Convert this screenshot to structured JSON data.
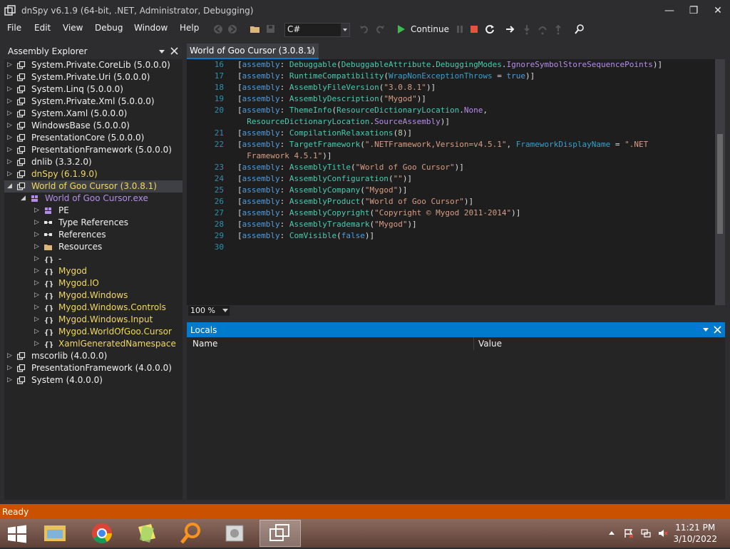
{
  "window": {
    "title": "dnSpy v6.1.9 (64-bit, .NET, Administrator, Debugging)",
    "minimize": "—",
    "maximize": "❐",
    "close": "✕"
  },
  "menu": [
    "File",
    "Edit",
    "View",
    "Debug",
    "Window",
    "Help"
  ],
  "toolbar": {
    "language": "C#",
    "continue_label": "Continue"
  },
  "explorer": {
    "title": "Assembly Explorer",
    "items": [
      {
        "label": "System.Private.CoreLib (5.0.0.0)",
        "level": 0,
        "kind": "assembly",
        "expanded": false,
        "color": "#f1f1f1"
      },
      {
        "label": "System.Private.Uri (5.0.0.0)",
        "level": 0,
        "kind": "assembly",
        "expanded": false,
        "color": "#f1f1f1"
      },
      {
        "label": "System.Linq (5.0.0.0)",
        "level": 0,
        "kind": "assembly",
        "expanded": false,
        "color": "#f1f1f1"
      },
      {
        "label": "System.Private.Xml (5.0.0.0)",
        "level": 0,
        "kind": "assembly",
        "expanded": false,
        "color": "#f1f1f1"
      },
      {
        "label": "System.Xaml (5.0.0.0)",
        "level": 0,
        "kind": "assembly",
        "expanded": false,
        "color": "#f1f1f1"
      },
      {
        "label": "WindowsBase (5.0.0.0)",
        "level": 0,
        "kind": "assembly",
        "expanded": false,
        "color": "#f1f1f1"
      },
      {
        "label": "PresentationCore (5.0.0.0)",
        "level": 0,
        "kind": "assembly",
        "expanded": false,
        "color": "#f1f1f1"
      },
      {
        "label": "PresentationFramework (5.0.0.0)",
        "level": 0,
        "kind": "assembly",
        "expanded": false,
        "color": "#f1f1f1"
      },
      {
        "label": "dnlib (3.3.2.0)",
        "level": 0,
        "kind": "assembly",
        "expanded": false,
        "color": "#f1f1f1"
      },
      {
        "label": "dnSpy (6.1.9.0)",
        "level": 0,
        "kind": "assembly-yellow",
        "expanded": false,
        "color": "#f2d860"
      },
      {
        "label": "World of Goo Cursor (3.0.8.1)",
        "level": 0,
        "kind": "assembly-yellow",
        "expanded": true,
        "color": "#f2d860",
        "selected": true
      },
      {
        "label": "World of Goo Cursor.exe",
        "level": 1,
        "kind": "module",
        "expanded": true,
        "color": "#b48ee6"
      },
      {
        "label": "PE",
        "level": 2,
        "kind": "pe",
        "expanded": false,
        "color": "#f1f1f1"
      },
      {
        "label": "Type References",
        "level": 2,
        "kind": "refs",
        "expanded": false,
        "color": "#f1f1f1"
      },
      {
        "label": "References",
        "level": 2,
        "kind": "refs",
        "expanded": false,
        "color": "#f1f1f1"
      },
      {
        "label": "Resources",
        "level": 2,
        "kind": "folder",
        "expanded": false,
        "color": "#f1f1f1"
      },
      {
        "label": "-",
        "level": 2,
        "kind": "namespace",
        "expanded": false,
        "color": "#f1f1f1"
      },
      {
        "label": "Mygod",
        "level": 2,
        "kind": "namespace",
        "expanded": false,
        "color": "#f2d860"
      },
      {
        "label": "Mygod.IO",
        "level": 2,
        "kind": "namespace",
        "expanded": false,
        "color": "#f2d860"
      },
      {
        "label": "Mygod.Windows",
        "level": 2,
        "kind": "namespace",
        "expanded": false,
        "color": "#f2d860"
      },
      {
        "label": "Mygod.Windows.Controls",
        "level": 2,
        "kind": "namespace",
        "expanded": false,
        "color": "#f2d860"
      },
      {
        "label": "Mygod.Windows.Input",
        "level": 2,
        "kind": "namespace",
        "expanded": false,
        "color": "#f2d860"
      },
      {
        "label": "Mygod.WorldOfGoo.Cursor",
        "level": 2,
        "kind": "namespace",
        "expanded": false,
        "color": "#f2d860"
      },
      {
        "label": "XamlGeneratedNamespace",
        "level": 2,
        "kind": "namespace",
        "expanded": false,
        "color": "#f2d860"
      },
      {
        "label": "mscorlib (4.0.0.0)",
        "level": 0,
        "kind": "assembly",
        "expanded": false,
        "color": "#f1f1f1"
      },
      {
        "label": "PresentationFramework (4.0.0.0)",
        "level": 0,
        "kind": "assembly",
        "expanded": false,
        "color": "#f1f1f1"
      },
      {
        "label": "System (4.0.0.0)",
        "level": 0,
        "kind": "assembly",
        "expanded": false,
        "color": "#f1f1f1"
      }
    ]
  },
  "editor": {
    "tab": "World of Goo Cursor (3.0.8.1)",
    "zoom": "100 %",
    "colors": {
      "keyword": "#569cd6",
      "type": "#4ec9b0",
      "string": "#d69d85",
      "number": "#b5cea8",
      "enum": "#b48ee6",
      "plain": "#dcdcdc",
      "param": "#3e9ec5"
    },
    "lines": [
      {
        "n": "16",
        "s": [
          [
            "[",
            "plain"
          ],
          [
            "assembly",
            "keyword"
          ],
          [
            ": ",
            "plain"
          ],
          [
            "Debuggable",
            "type"
          ],
          [
            "(",
            "plain"
          ],
          [
            "DebuggableAttribute",
            "type"
          ],
          [
            ".",
            "plain"
          ],
          [
            "DebuggingModes",
            "type"
          ],
          [
            ".",
            "plain"
          ],
          [
            "IgnoreSymbolStoreSequencePoints",
            "enum"
          ],
          [
            ")]",
            "plain"
          ]
        ]
      },
      {
        "n": "17",
        "s": [
          [
            "[",
            "plain"
          ],
          [
            "assembly",
            "keyword"
          ],
          [
            ": ",
            "plain"
          ],
          [
            "RuntimeCompatibility",
            "type"
          ],
          [
            "(",
            "plain"
          ],
          [
            "WrapNonExceptionThrows",
            "param"
          ],
          [
            " = ",
            "plain"
          ],
          [
            "true",
            "keyword"
          ],
          [
            ")]",
            "plain"
          ]
        ]
      },
      {
        "n": "18",
        "s": [
          [
            "[",
            "plain"
          ],
          [
            "assembly",
            "keyword"
          ],
          [
            ": ",
            "plain"
          ],
          [
            "AssemblyFileVersion",
            "type"
          ],
          [
            "(",
            "plain"
          ],
          [
            "\"3.0.8.1\"",
            "string"
          ],
          [
            ")]",
            "plain"
          ]
        ]
      },
      {
        "n": "19",
        "s": [
          [
            "[",
            "plain"
          ],
          [
            "assembly",
            "keyword"
          ],
          [
            ": ",
            "plain"
          ],
          [
            "AssemblyDescription",
            "type"
          ],
          [
            "(",
            "plain"
          ],
          [
            "\"Mygod\"",
            "string"
          ],
          [
            ")]",
            "plain"
          ]
        ]
      },
      {
        "n": "20",
        "s": [
          [
            "[",
            "plain"
          ],
          [
            "assembly",
            "keyword"
          ],
          [
            ": ",
            "plain"
          ],
          [
            "ThemeInfo",
            "type"
          ],
          [
            "(",
            "plain"
          ],
          [
            "ResourceDictionaryLocation",
            "type"
          ],
          [
            ".",
            "plain"
          ],
          [
            "None",
            "enum"
          ],
          [
            ",",
            "plain"
          ]
        ]
      },
      {
        "n": "",
        "s": [
          [
            "  ResourceDictionaryLocation",
            "type"
          ],
          [
            ".",
            "plain"
          ],
          [
            "SourceAssembly",
            "enum"
          ],
          [
            ")]",
            "plain"
          ]
        ]
      },
      {
        "n": "21",
        "s": [
          [
            "[",
            "plain"
          ],
          [
            "assembly",
            "keyword"
          ],
          [
            ": ",
            "plain"
          ],
          [
            "CompilationRelaxations",
            "type"
          ],
          [
            "(",
            "plain"
          ],
          [
            "8",
            "number"
          ],
          [
            ")]",
            "plain"
          ]
        ]
      },
      {
        "n": "22",
        "s": [
          [
            "[",
            "plain"
          ],
          [
            "assembly",
            "keyword"
          ],
          [
            ": ",
            "plain"
          ],
          [
            "TargetFramework",
            "type"
          ],
          [
            "(",
            "plain"
          ],
          [
            "\".NETFramework,Version=v4.5.1\"",
            "string"
          ],
          [
            ", ",
            "plain"
          ],
          [
            "FrameworkDisplayName",
            "param"
          ],
          [
            " = ",
            "plain"
          ],
          [
            "\".NET",
            "string"
          ]
        ]
      },
      {
        "n": "",
        "s": [
          [
            "  Framework 4.5.1\"",
            "string"
          ],
          [
            ")]",
            "plain"
          ]
        ]
      },
      {
        "n": "23",
        "s": [
          [
            "[",
            "plain"
          ],
          [
            "assembly",
            "keyword"
          ],
          [
            ": ",
            "plain"
          ],
          [
            "AssemblyTitle",
            "type"
          ],
          [
            "(",
            "plain"
          ],
          [
            "\"World of Goo Cursor\"",
            "string"
          ],
          [
            ")]",
            "plain"
          ]
        ]
      },
      {
        "n": "24",
        "s": [
          [
            "[",
            "plain"
          ],
          [
            "assembly",
            "keyword"
          ],
          [
            ": ",
            "plain"
          ],
          [
            "AssemblyConfiguration",
            "type"
          ],
          [
            "(",
            "plain"
          ],
          [
            "\"\"",
            "string"
          ],
          [
            ")]",
            "plain"
          ]
        ]
      },
      {
        "n": "25",
        "s": [
          [
            "[",
            "plain"
          ],
          [
            "assembly",
            "keyword"
          ],
          [
            ": ",
            "plain"
          ],
          [
            "AssemblyCompany",
            "type"
          ],
          [
            "(",
            "plain"
          ],
          [
            "\"Mygod\"",
            "string"
          ],
          [
            ")]",
            "plain"
          ]
        ]
      },
      {
        "n": "26",
        "s": [
          [
            "[",
            "plain"
          ],
          [
            "assembly",
            "keyword"
          ],
          [
            ": ",
            "plain"
          ],
          [
            "AssemblyProduct",
            "type"
          ],
          [
            "(",
            "plain"
          ],
          [
            "\"World of Goo Cursor\"",
            "string"
          ],
          [
            ")]",
            "plain"
          ]
        ]
      },
      {
        "n": "27",
        "s": [
          [
            "[",
            "plain"
          ],
          [
            "assembly",
            "keyword"
          ],
          [
            ": ",
            "plain"
          ],
          [
            "AssemblyCopyright",
            "type"
          ],
          [
            "(",
            "plain"
          ],
          [
            "\"Copyright © Mygod 2011-2014\"",
            "string"
          ],
          [
            ")]",
            "plain"
          ]
        ]
      },
      {
        "n": "28",
        "s": [
          [
            "[",
            "plain"
          ],
          [
            "assembly",
            "keyword"
          ],
          [
            ": ",
            "plain"
          ],
          [
            "AssemblyTrademark",
            "type"
          ],
          [
            "(",
            "plain"
          ],
          [
            "\"Mygod\"",
            "string"
          ],
          [
            ")]",
            "plain"
          ]
        ]
      },
      {
        "n": "29",
        "s": [
          [
            "[",
            "plain"
          ],
          [
            "assembly",
            "keyword"
          ],
          [
            ": ",
            "plain"
          ],
          [
            "ComVisible",
            "type"
          ],
          [
            "(",
            "plain"
          ],
          [
            "false",
            "keyword"
          ],
          [
            ")]",
            "plain"
          ]
        ]
      },
      {
        "n": "30",
        "s": []
      }
    ]
  },
  "locals": {
    "title": "Locals",
    "columns": [
      "Name",
      "Value"
    ]
  },
  "status": {
    "text": "Ready"
  },
  "taskbar": {
    "time": "11:21 PM",
    "date": "3/10/2022"
  }
}
